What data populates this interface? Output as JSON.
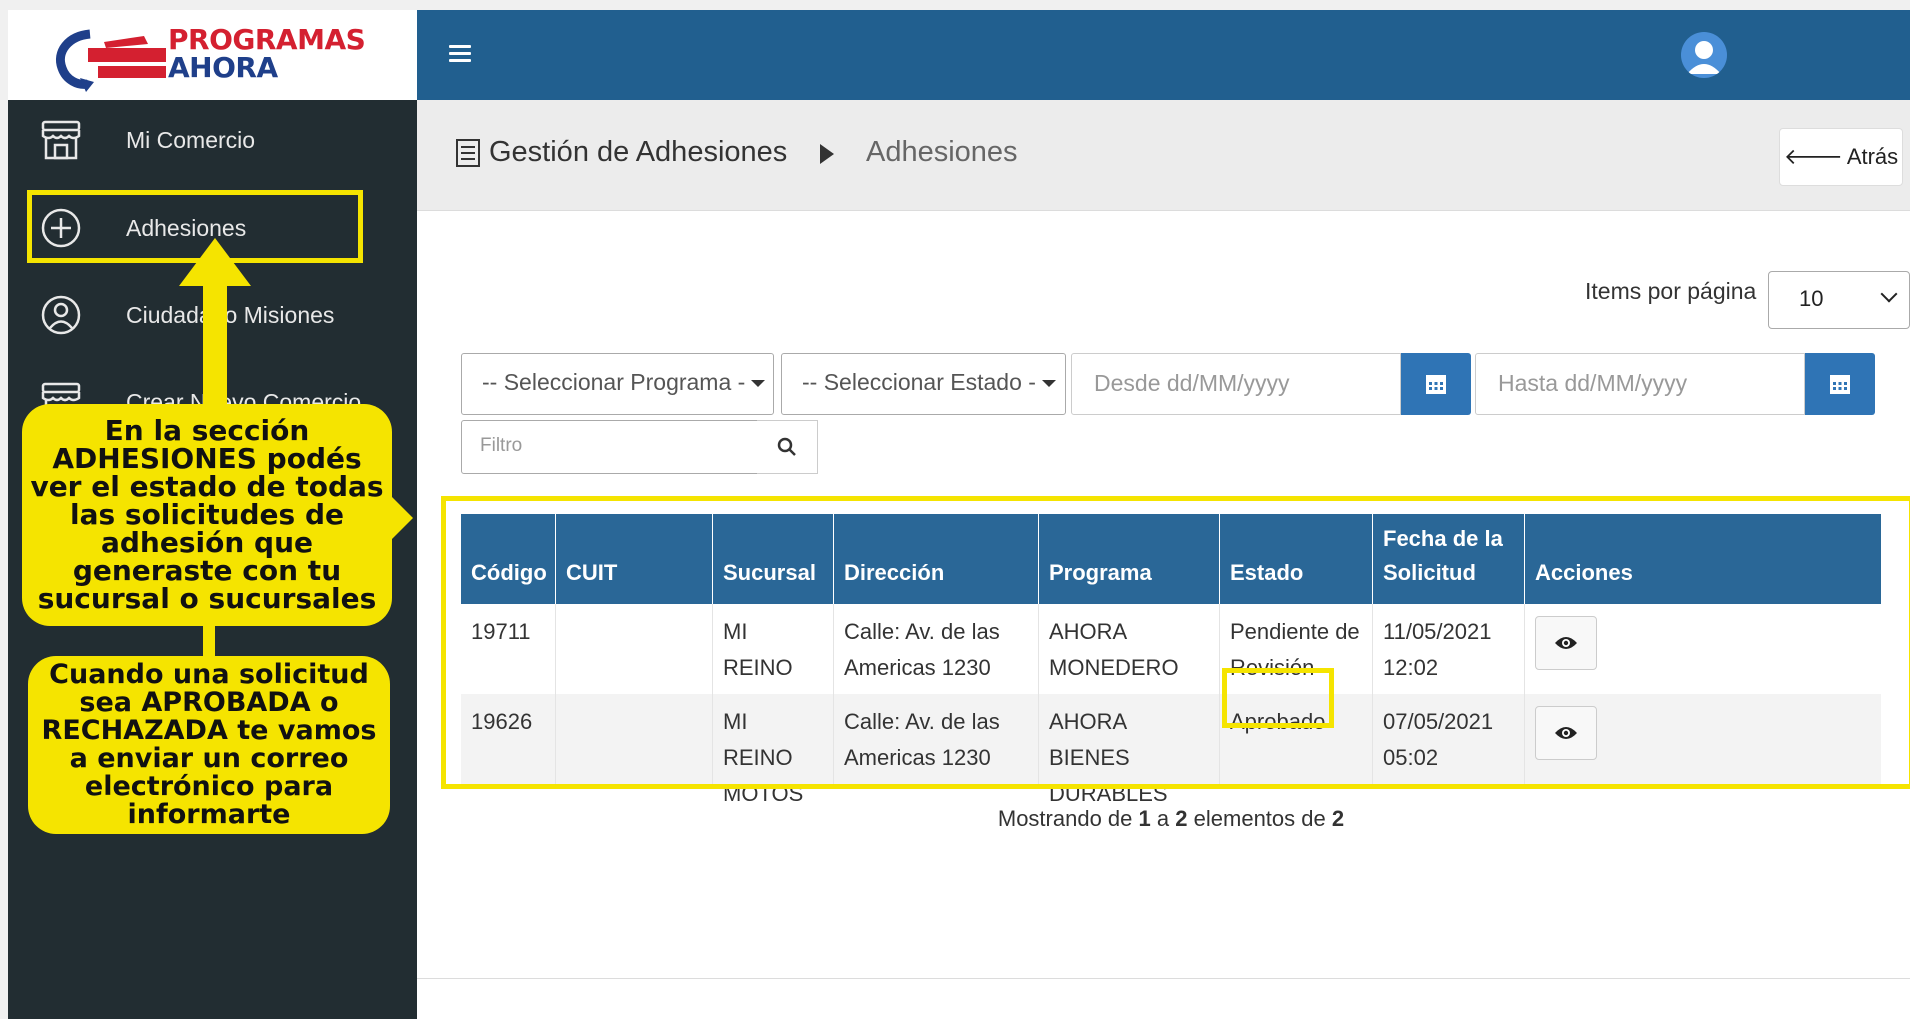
{
  "brand": {
    "line1": "PROGRAMAS",
    "line2": "AHORA"
  },
  "sidebar": {
    "items": [
      {
        "label": "Mi Comercio",
        "icon": "store-icon"
      },
      {
        "label": "Adhesiones",
        "icon": "plus-circle-icon"
      },
      {
        "label": "Ciudadano Misiones",
        "icon": "user-circle-icon"
      },
      {
        "label": "Crear Nuevo Comercio",
        "icon": "store-add-icon"
      }
    ]
  },
  "header": {
    "menu_icon": "hamburger-icon",
    "avatar_icon": "user-avatar-icon"
  },
  "breadcrumb": {
    "root": "Gestión de Adhesiones",
    "current": "Adhesiones",
    "back_label": "Atrás"
  },
  "controls": {
    "items_per_page_label": "Items por página",
    "items_per_page_value": "10",
    "programa_placeholder": "-- Seleccionar Programa -",
    "estado_placeholder": "-- Seleccionar Estado -",
    "desde_placeholder": "Desde dd/MM/yyyy",
    "hasta_placeholder": "Hasta dd/MM/yyyy",
    "filtro_placeholder": "Filtro"
  },
  "table": {
    "columns": [
      "Código",
      "CUIT",
      "Sucursal",
      "Dirección",
      "Programa",
      "Estado",
      "Fecha de la Solicitud",
      "Acciones"
    ],
    "rows": [
      {
        "codigo": "19711",
        "cuit": "",
        "sucursal": "MI REINO MOTOS",
        "direccion": "Calle: Av. de las Americas 1230",
        "programa": "AHORA MONEDERO",
        "estado": "Pendiente de Revisión",
        "fecha": "11/05/2021 12:02"
      },
      {
        "codigo": "19626",
        "cuit": "",
        "sucursal": "MI REINO MOTOS",
        "direccion": "Calle: Av. de las Americas 1230",
        "programa": "AHORA BIENES DURABLES",
        "estado": "Aprobado",
        "fecha": "07/05/2021 05:02"
      }
    ],
    "footer": {
      "prefix": "Mostrando de",
      "from": "1",
      "to_word": "a",
      "to": "2",
      "mid": "elementos de",
      "total": "2"
    }
  },
  "callouts": {
    "adhesiones": "En la sección ADHESIONES podés ver el estado de todas las solicitudes de adhesión que generaste con tu sucursal o sucursales",
    "email": "Cuando una solicitud sea APROBADA o RECHAZADA te vamos a enviar un correo electrónico para informarte"
  },
  "colors": {
    "header": "#215f8f",
    "sidebar": "#222d32",
    "highlight": "#f5e400",
    "table_header": "#2a6797",
    "button": "#2f74b5"
  }
}
